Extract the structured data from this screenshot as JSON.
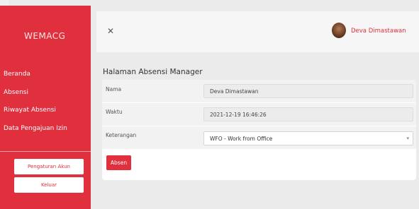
{
  "sidebar": {
    "logo": "WEMACG",
    "items": [
      {
        "label": "Beranda"
      },
      {
        "label": "Absensi"
      },
      {
        "label": "Riwayat Absensi"
      },
      {
        "label": "Data Pengajuan Izin"
      }
    ],
    "account_button": "Pengaturan Akun",
    "logout_button": "Keluar"
  },
  "header": {
    "close_icon": "close-icon",
    "user_name": "Deva Dimastawan"
  },
  "main": {
    "title": "Halaman Absensi Manager",
    "fields": {
      "name_label": "Nama",
      "name_value": "Deva Dimastawan",
      "time_label": "Waktu",
      "time_value": "2021-12-19 16:46:26",
      "note_label": "Keterangan",
      "note_selected": "WFO - Work from Office"
    },
    "submit_button": "Absen"
  },
  "colors": {
    "accent": "#e0303e",
    "background": "#ebebeb"
  }
}
